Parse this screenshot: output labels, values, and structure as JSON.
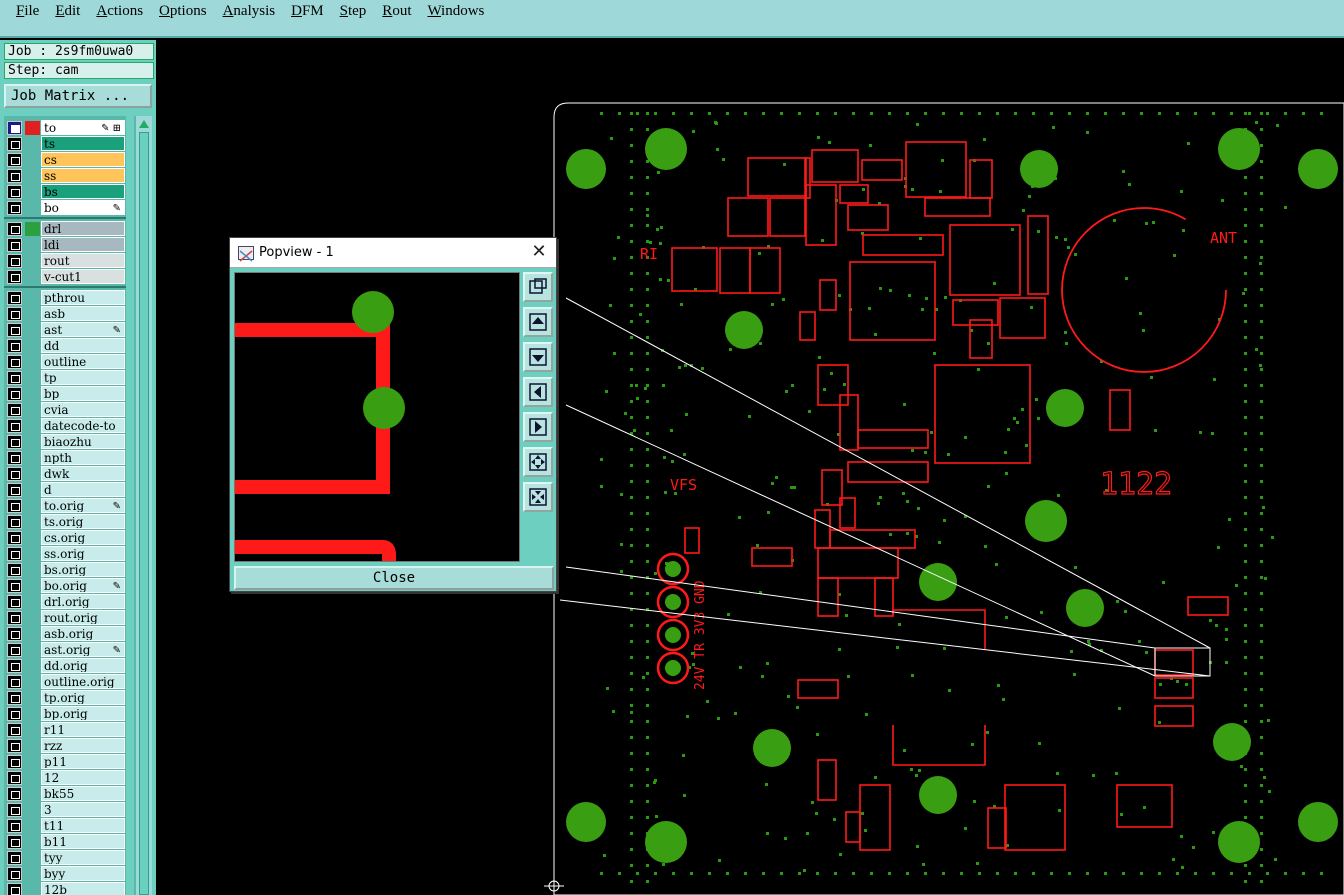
{
  "menu": [
    "File",
    "Edit",
    "Actions",
    "Options",
    "Analysis",
    "DFM",
    "Step",
    "Rout",
    "Windows"
  ],
  "job": {
    "job_line": "Job : 2s9fm0uwa0",
    "step_line": "Step: cam",
    "matrix_button": "Job Matrix ..."
  },
  "colors": {
    "panel": "#6ccfbf",
    "menubar": "#9fd8d8",
    "copper": "#ff1a1a",
    "pad": "#3a9e12",
    "outline": "#ffffff"
  },
  "layers": [
    {
      "name": "to",
      "color": "#ffffff",
      "flag": "✎ ⊞",
      "on": true,
      "ind": "#e02020"
    },
    {
      "name": "ts",
      "color": "#1aa07a",
      "flag": ""
    },
    {
      "name": "cs",
      "color": "#ffc45a",
      "flag": ""
    },
    {
      "name": "ss",
      "color": "#ffc45a",
      "flag": ""
    },
    {
      "name": "bs",
      "color": "#1aa07a",
      "flag": ""
    },
    {
      "name": "bo",
      "color": "#ffffff",
      "flag": "✎"
    },
    {
      "name": "drl",
      "color": "#a8b8c0",
      "flag": "",
      "ind": "#2aa040"
    },
    {
      "name": "ldi",
      "color": "#a8b8c0",
      "flag": ""
    },
    {
      "name": "rout",
      "color": "#d8e0e0",
      "flag": ""
    },
    {
      "name": "v-cut1",
      "color": "#d8e0e0",
      "flag": ""
    },
    {
      "name": "pthrou",
      "color": "#c8ecec",
      "flag": ""
    },
    {
      "name": "asb",
      "color": "#c8ecec",
      "flag": ""
    },
    {
      "name": "ast",
      "color": "#c8ecec",
      "flag": "✎"
    },
    {
      "name": "dd",
      "color": "#c8ecec",
      "flag": ""
    },
    {
      "name": "outline",
      "color": "#c8ecec",
      "flag": ""
    },
    {
      "name": "tp",
      "color": "#c8ecec",
      "flag": ""
    },
    {
      "name": "bp",
      "color": "#c8ecec",
      "flag": ""
    },
    {
      "name": "cvia",
      "color": "#c8ecec",
      "flag": ""
    },
    {
      "name": "datecode-to",
      "color": "#c8ecec",
      "flag": ""
    },
    {
      "name": "biaozhu",
      "color": "#c8ecec",
      "flag": ""
    },
    {
      "name": "npth",
      "color": "#c8ecec",
      "flag": ""
    },
    {
      "name": "dwk",
      "color": "#c8ecec",
      "flag": ""
    },
    {
      "name": "d",
      "color": "#c8ecec",
      "flag": ""
    },
    {
      "name": "to.orig",
      "color": "#c8ecec",
      "flag": "✎"
    },
    {
      "name": "ts.orig",
      "color": "#c8ecec",
      "flag": ""
    },
    {
      "name": "cs.orig",
      "color": "#c8ecec",
      "flag": ""
    },
    {
      "name": "ss.orig",
      "color": "#c8ecec",
      "flag": ""
    },
    {
      "name": "bs.orig",
      "color": "#c8ecec",
      "flag": ""
    },
    {
      "name": "bo.orig",
      "color": "#c8ecec",
      "flag": "✎"
    },
    {
      "name": "drl.orig",
      "color": "#c8ecec",
      "flag": ""
    },
    {
      "name": "rout.orig",
      "color": "#c8ecec",
      "flag": ""
    },
    {
      "name": "asb.orig",
      "color": "#c8ecec",
      "flag": ""
    },
    {
      "name": "ast.orig",
      "color": "#c8ecec",
      "flag": "✎"
    },
    {
      "name": "dd.orig",
      "color": "#c8ecec",
      "flag": ""
    },
    {
      "name": "outline.orig",
      "color": "#c8ecec",
      "flag": ""
    },
    {
      "name": "tp.orig",
      "color": "#c8ecec",
      "flag": ""
    },
    {
      "name": "bp.orig",
      "color": "#c8ecec",
      "flag": ""
    },
    {
      "name": "r11",
      "color": "#c8ecec",
      "flag": ""
    },
    {
      "name": "rzz",
      "color": "#c8ecec",
      "flag": ""
    },
    {
      "name": "p11",
      "color": "#c8ecec",
      "flag": ""
    },
    {
      "name": "12",
      "color": "#c8ecec",
      "flag": ""
    },
    {
      "name": "bk55",
      "color": "#c8ecec",
      "flag": ""
    },
    {
      "name": "3",
      "color": "#c8ecec",
      "flag": ""
    },
    {
      "name": "t11",
      "color": "#c8ecec",
      "flag": ""
    },
    {
      "name": "b11",
      "color": "#c8ecec",
      "flag": ""
    },
    {
      "name": "tyy",
      "color": "#c8ecec",
      "flag": ""
    },
    {
      "name": "byy",
      "color": "#c8ecec",
      "flag": ""
    },
    {
      "name": "12b",
      "color": "#c8ecec",
      "flag": ""
    }
  ],
  "popview": {
    "title": "Popview - 1",
    "close_label": "Close",
    "close_x": "✕"
  },
  "board_labels": {
    "ri": "RI",
    "ant": "ANT",
    "vfs": "VFS",
    "code": "1122",
    "pins": "24V TR 3V3 GND"
  },
  "tool_icons": [
    "zoom-fit-icon",
    "pan-up-icon",
    "pan-down-icon",
    "pan-left-icon",
    "pan-right-icon",
    "zoom-in-icon",
    "zoom-out-icon"
  ]
}
